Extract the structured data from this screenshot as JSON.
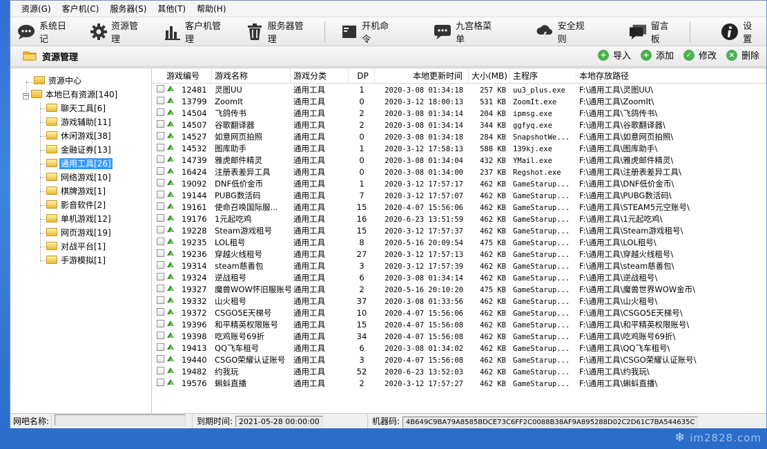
{
  "menu": [
    "资源(G)",
    "客户机(C)",
    "服务器(S)",
    "其他(T)",
    "帮助(H)"
  ],
  "toolbar": [
    {
      "label": "系统日记",
      "icon": "chat-bubble-icon"
    },
    {
      "label": "资源管理",
      "icon": "gear-icon"
    },
    {
      "label": "客户机管理",
      "icon": "bar-chart-icon"
    },
    {
      "label": "服务器管理",
      "icon": "trash-icon"
    },
    {
      "label": "开机命令",
      "icon": "terminal-icon"
    },
    {
      "label": "九宫格菜单",
      "icon": "chat-dots-icon"
    },
    {
      "label": "安全规则",
      "icon": "cloud-bolt-icon"
    },
    {
      "label": "留言板",
      "icon": "message-board-icon"
    },
    {
      "label": "设置",
      "icon": "info-icon"
    }
  ],
  "section_title": "资源管理",
  "actions": [
    {
      "label": "导入",
      "icon": "plus-circle-icon",
      "color": "#4caf50"
    },
    {
      "label": "添加",
      "icon": "plus-circle-icon",
      "color": "#4caf50"
    },
    {
      "label": "修改",
      "icon": "check-circle-icon",
      "color": "#4caf50"
    },
    {
      "label": "删除",
      "icon": "close-circle-icon",
      "color": "#4caf50"
    }
  ],
  "tree": {
    "root": "资源中心",
    "local": "本地已有资源[140]",
    "children": [
      "聊天工具[6]",
      "游戏辅助[11]",
      "休闲游戏[38]",
      "金融证券[13]",
      "通用工具[26]",
      "网络游戏[10]",
      "棋牌游戏[1]",
      "影音软件[2]",
      "单机游戏[12]",
      "网页游戏[19]",
      "对战平台[1]",
      "手游模拟[1]"
    ],
    "selected_index": 4
  },
  "columns": [
    "游戏编号",
    "游戏名称",
    "游戏分类",
    "DP",
    "本地更新时间",
    "大小(MB)",
    "主程序",
    "本地存放路径"
  ],
  "rows": [
    [
      "12481",
      "灵图UU",
      "通用工具",
      "1",
      "2020-3-08 01:34:18",
      "257 KB",
      "uu3_plus.exe",
      "F:\\通用工具\\灵图UU\\"
    ],
    [
      "13799",
      "ZoomIt",
      "通用工具",
      "0",
      "2020-3-12 18:00:13",
      "531 KB",
      "ZoomIt.exe",
      "F:\\通用工具\\ZoomIt\\"
    ],
    [
      "14504",
      "飞鸽传书",
      "通用工具",
      "2",
      "2020-3-08 01:34:14",
      "204 KB",
      "ipmsg.exe",
      "F:\\通用工具\\飞鸽传书\\"
    ],
    [
      "14507",
      "谷歌翻译器",
      "通用工具",
      "2",
      "2020-3-08 01:34:14",
      "344 KB",
      "ggfyq.exe",
      "F:\\通用工具\\谷歌翻译器\\"
    ],
    [
      "14527",
      "如意网页拍照",
      "通用工具",
      "0",
      "2020-3-08 01:34:18",
      "284 KB",
      "SnapshotWe...",
      "F:\\通用工具\\如意网页拍照\\"
    ],
    [
      "14532",
      "图库助手",
      "通用工具",
      "1",
      "2020-3-12 17:58:13",
      "588 KB",
      "139kj.exe",
      "F:\\通用工具\\图库助手\\"
    ],
    [
      "14739",
      "雅虎邮件精灵",
      "通用工具",
      "0",
      "2020-3-08 01:34:04",
      "432 KB",
      "YMail.exe",
      "F:\\通用工具\\雅虎邮件精灵\\"
    ],
    [
      "16424",
      "注册表差异工具",
      "通用工具",
      "0",
      "2020-3-08 01:34:00",
      "237 KB",
      "Regshot.exe",
      "F:\\通用工具\\注册表差异工具\\"
    ],
    [
      "19092",
      "DNF低价金币",
      "通用工具",
      "1",
      "2020-3-12 17:57:17",
      "462 KB",
      "GameStarup...",
      "F:\\通用工具\\DNF低价金币\\"
    ],
    [
      "19144",
      "PUBG数活码",
      "通用工具",
      "7",
      "2020-3-12 17:57:07",
      "462 KB",
      "GameStarup...",
      "F:\\通用工具\\PUBG数活码\\"
    ],
    [
      "19161",
      "使命召唤国际服...",
      "通用工具",
      "15",
      "2020-4-07 15:56:06",
      "462 KB",
      "GameStarup...",
      "F:\\通用工具\\STEAM5元空账号\\"
    ],
    [
      "19176",
      "1元起吃鸡",
      "通用工具",
      "16",
      "2020-6-23 13:51:59",
      "462 KB",
      "GameStarup...",
      "F:\\通用工具\\1元起吃鸡\\"
    ],
    [
      "19228",
      "Steam游戏租号",
      "通用工具",
      "15",
      "2020-3-12 17:57:37",
      "462 KB",
      "GameStarup...",
      "F:\\通用工具\\Steam游戏租号\\"
    ],
    [
      "19235",
      "LOL租号",
      "通用工具",
      "8",
      "2020-5-16 20:09:54",
      "475 KB",
      "GameStarup...",
      "F:\\通用工具\\LOL租号\\"
    ],
    [
      "19236",
      "穿越火线租号",
      "通用工具",
      "27",
      "2020-3-12 17:57:13",
      "462 KB",
      "GameStarup...",
      "F:\\通用工具\\穿越火线租号\\"
    ],
    [
      "19314",
      "steam慈善包",
      "通用工具",
      "3",
      "2020-3-12 17:57:39",
      "462 KB",
      "GameStarup...",
      "F:\\通用工具\\steam慈善包\\"
    ],
    [
      "19324",
      "逆战租号",
      "通用工具",
      "6",
      "2020-3-08 01:34:14",
      "462 KB",
      "GameStarup...",
      "F:\\通用工具\\逆战租号\\"
    ],
    [
      "19327",
      "魔兽WOW怀旧服账号",
      "通用工具",
      "2",
      "2020-5-16 20:10:20",
      "475 KB",
      "GameStarup...",
      "F:\\通用工具\\魔兽世界WOW金币\\"
    ],
    [
      "19332",
      "山火租号",
      "通用工具",
      "37",
      "2020-3-08 01:33:56",
      "462 KB",
      "GameStarup...",
      "F:\\通用工具\\山火租号\\"
    ],
    [
      "19372",
      "CSGO5E天梯号",
      "通用工具",
      "10",
      "2020-4-07 15:56:06",
      "462 KB",
      "GameStarup...",
      "F:\\通用工具\\CSGO5E天梯号\\"
    ],
    [
      "19396",
      "和平精英权限账号",
      "通用工具",
      "15",
      "2020-4-07 15:56:08",
      "462 KB",
      "GameStarup...",
      "F:\\通用工具\\和平精英权限账号\\"
    ],
    [
      "19398",
      "吃鸡账号69折",
      "通用工具",
      "34",
      "2020-4-07 15:56:08",
      "462 KB",
      "GameStarup...",
      "F:\\通用工具\\吃鸡账号69折\\"
    ],
    [
      "19413",
      "QQ飞车租号",
      "通用工具",
      "6",
      "2020-3-08 01:34:02",
      "462 KB",
      "GameStarup...",
      "F:\\通用工具\\QQ飞车租号\\"
    ],
    [
      "19440",
      "CSGO荣耀认证账号",
      "通用工具",
      "3",
      "2020-4-07 15:56:08",
      "462 KB",
      "GameStarup...",
      "F:\\通用工具\\CSGO荣耀认证账号\\"
    ],
    [
      "19482",
      "约我玩",
      "通用工具",
      "52",
      "2020-6-23 13:52:03",
      "462 KB",
      "GameStarup...",
      "F:\\通用工具\\约我玩\\"
    ],
    [
      "19576",
      "蝌蚪直播",
      "通用工具",
      "2",
      "2020-3-12 17:57:27",
      "462 KB",
      "GameStarup...",
      "F:\\通用工具\\蝌蚪直播\\"
    ]
  ],
  "status": {
    "netbar_label": "网吧名称:",
    "netbar_value": "",
    "expire_label": "到期时间:",
    "expire_value": "2021-05-28 00:00:00",
    "machine_label": "机器码:",
    "machine_value": "4B649C9BA79A8585BDCE73C6FF2C0088B38AF9A895288D02C2D61C7BA544635C"
  },
  "watermark": "im2828.com"
}
